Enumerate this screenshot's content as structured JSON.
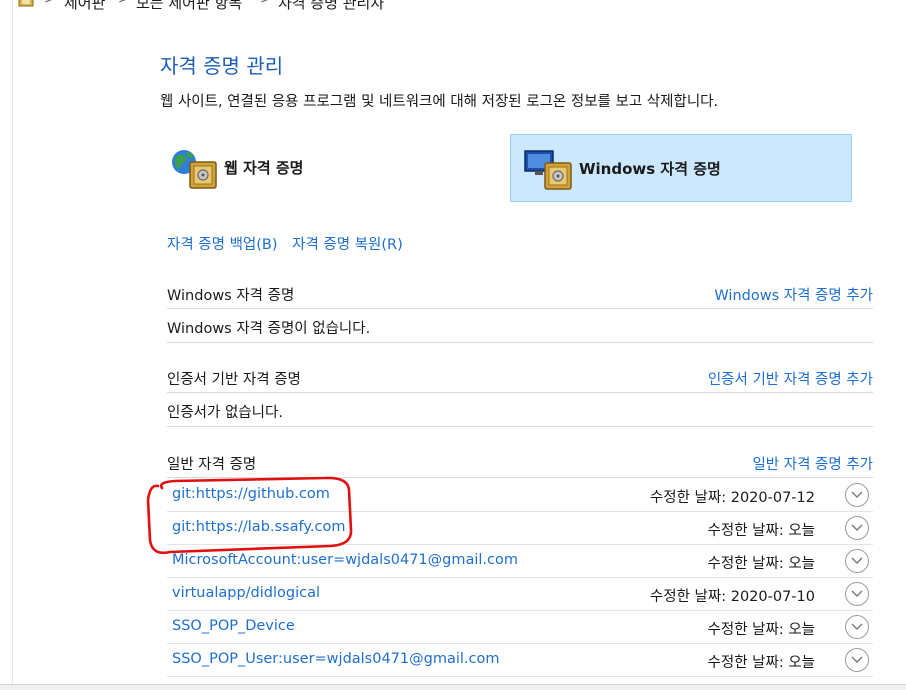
{
  "breadcrumb": {
    "items": [
      "제어판",
      "모든 제어판 항목",
      "자격 증명 관리자"
    ]
  },
  "page": {
    "title": "자격 증명 관리",
    "description": "웹 사이트, 연결된 응용 프로그램 및 네트워크에 대해 저장된 로그온 정보를 보고 삭제합니다."
  },
  "tabs": {
    "web": "웹 자격 증명",
    "windows": "Windows 자격 증명",
    "selected": "windows"
  },
  "actions": {
    "backup": "자격 증명 백업(B)",
    "restore": "자격 증명 복원(R)"
  },
  "sections": {
    "windows": {
      "title": "Windows 자격 증명",
      "add": "Windows 자격 증명 추가",
      "empty": "Windows 자격 증명이 없습니다."
    },
    "certificate": {
      "title": "인증서 기반 자격 증명",
      "add": "인증서 기반 자격 증명 추가",
      "empty": "인증서가 없습니다."
    },
    "generic": {
      "title": "일반 자격 증명",
      "add": "일반 자격 증명 추가"
    }
  },
  "generic_credentials": [
    {
      "name": "git:https://github.com",
      "modified": "수정한 날짜:  2020-07-12"
    },
    {
      "name": "git:https://lab.ssafy.com",
      "modified": "수정한 날짜:  오늘"
    },
    {
      "name": "MicrosoftAccount:user=wjdals0471@gmail.com",
      "modified": "수정한 날짜:  오늘"
    },
    {
      "name": "virtualapp/didlogical",
      "modified": "수정한 날짜:  2020-07-10"
    },
    {
      "name": "SSO_POP_Device",
      "modified": "수정한 날짜:  오늘"
    },
    {
      "name": "SSO_POP_User:user=wjdals0471@gmail.com",
      "modified": "수정한 날짜:  오늘"
    }
  ],
  "colors": {
    "link": "#1f6fd0",
    "title": "#1e5fb4",
    "selected_tab_bg": "#cce8ff",
    "annotation": "#e01010"
  }
}
